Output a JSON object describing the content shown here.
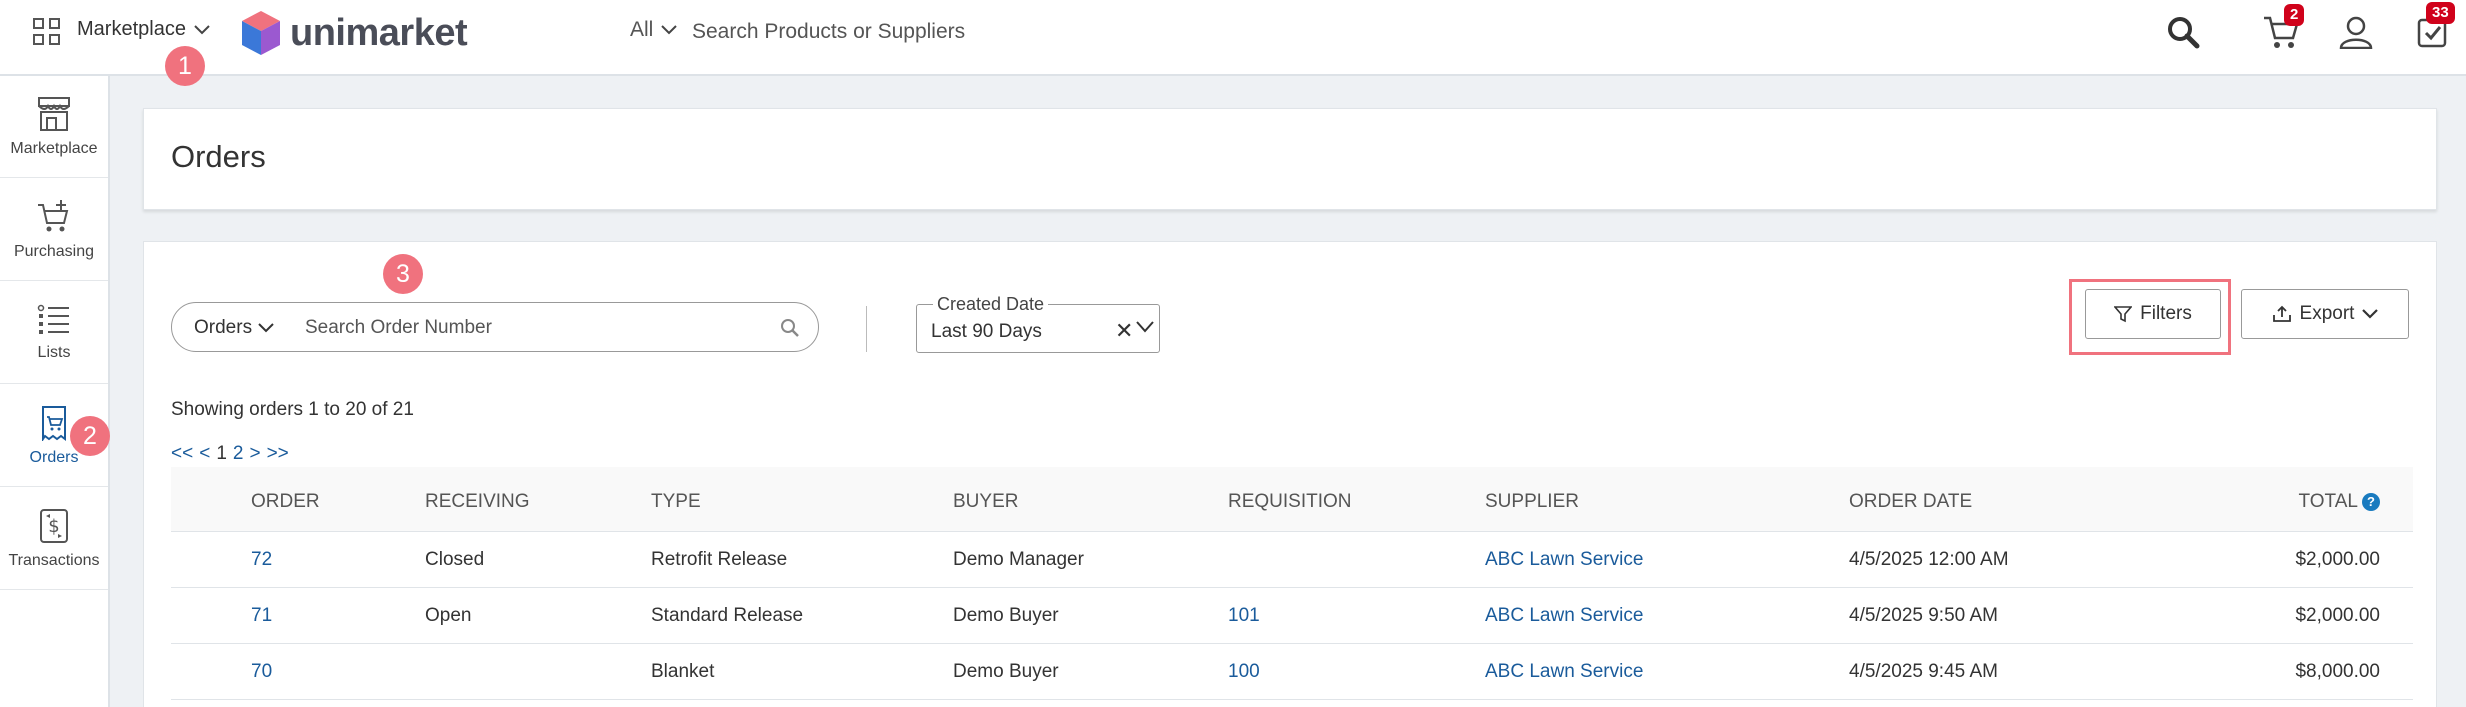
{
  "topbar": {
    "app_switcher_label": "Marketplace",
    "logo_text": "unimarket",
    "search_scope": "All",
    "search_placeholder": "Search Products or Suppliers",
    "cart_count": "2",
    "tasks_count": "33"
  },
  "markers": {
    "m1": "1",
    "m2": "2",
    "m3": "3"
  },
  "sidebar": {
    "items": [
      {
        "label": "Marketplace",
        "icon": "storefront-icon"
      },
      {
        "label": "Purchasing",
        "icon": "cart-plus-icon"
      },
      {
        "label": "Lists",
        "icon": "list-icon"
      },
      {
        "label": "Orders",
        "icon": "order-icon",
        "active": true
      },
      {
        "label": "Transactions",
        "icon": "transaction-icon"
      }
    ]
  },
  "page": {
    "title": "Orders"
  },
  "filters": {
    "search_scope": "Orders",
    "search_placeholder": "Search Order Number",
    "date_label": "Created Date",
    "date_value": "Last 90 Days",
    "filters_label": "Filters",
    "export_label": "Export"
  },
  "results": {
    "summary": "Showing orders 1 to 20 of 21",
    "pager": {
      "first": "<<",
      "prev": "<",
      "page1": "1",
      "page2": "2",
      "next": ">",
      "last": ">>"
    }
  },
  "table": {
    "columns": [
      "ORDER",
      "RECEIVING",
      "TYPE",
      "BUYER",
      "REQUISITION",
      "SUPPLIER",
      "ORDER DATE",
      "TOTAL"
    ],
    "rows": [
      {
        "order": "72",
        "receiving": "Closed",
        "type": "Retrofit Release",
        "buyer": "Demo Manager",
        "requisition": "",
        "supplier": "ABC Lawn Service",
        "order_date": "4/5/2025 12:00 AM",
        "total": "$2,000.00"
      },
      {
        "order": "71",
        "receiving": "Open",
        "type": "Standard Release",
        "buyer": "Demo Buyer",
        "requisition": "101",
        "supplier": "ABC Lawn Service",
        "order_date": "4/5/2025 9:50 AM",
        "total": "$2,000.00"
      },
      {
        "order": "70",
        "receiving": "",
        "type": "Blanket",
        "buyer": "Demo Buyer",
        "requisition": "100",
        "supplier": "ABC Lawn Service",
        "order_date": "4/5/2025 9:45 AM",
        "total": "$8,000.00"
      }
    ]
  },
  "colors": {
    "accent": "#1a5b9b",
    "marker": "#f0727e",
    "badge": "#d0021b"
  }
}
